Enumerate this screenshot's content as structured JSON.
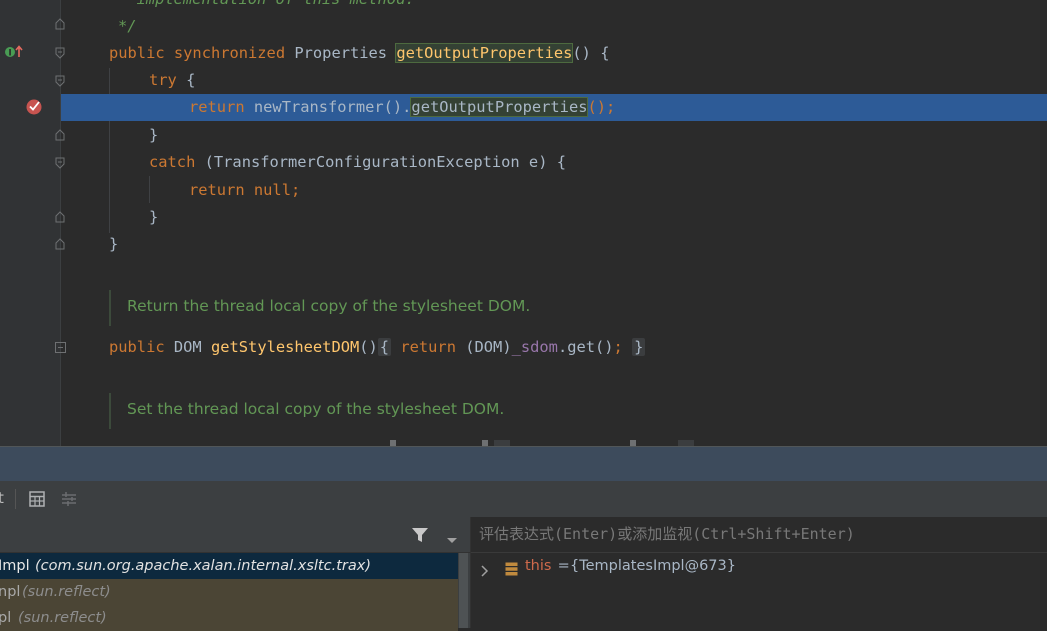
{
  "editor": {
    "lines": {
      "l0": "* implementation of this method.",
      "l1": "*/",
      "l2_kw1": "public",
      "l2_kw2": "synchronized",
      "l2_type": "Properties",
      "l2_fn": "getOutputProperties",
      "l2_rest": "() {",
      "l3_kw": "try",
      "l3_rest": "{",
      "l4_kw": "return",
      "l4_call": "newTransformer().",
      "l4_fn": "getOutputProperties",
      "l4_rest": "();",
      "l5": "}",
      "l6_kw": "catch",
      "l6_rest": "(TransformerConfigurationException e) {",
      "l7_kw": "return",
      "l7_rest": "null;",
      "l8": "}",
      "l9": "}",
      "doc1": "Return the thread local copy of the stylesheet DOM.",
      "l11_kw": "public",
      "l11_type": "DOM",
      "l11_fn": "getStylesheetDOM",
      "l11_parens": "()",
      "l11_fold_open": "{",
      "l11_return": "return",
      "l11_cast": "(DOM)",
      "l11_field": "_sdom",
      "l11_call": ".get()",
      "l11_semi": ";",
      "l11_fold_close": "}",
      "doc2": "Set the thread local copy of the stylesheet DOM."
    },
    "gutter": {
      "override_icon": "implementing-method-icon",
      "breakpoint_icon": "breakpoint-icon"
    }
  },
  "debugger": {
    "toolbar": {
      "left_glyph": "t",
      "table_icon": "table-view-icon",
      "settings_icon": "layout-settings-icon"
    },
    "frames": [
      {
        "name": "Impl",
        "pkg": "(com.sun.org.apache.xalan.internal.xsltc.trax)",
        "selected": true
      },
      {
        "name": "npl",
        "pkg": "(sun.reflect)",
        "selected": false
      },
      {
        "name": "pl",
        "pkg": "(sun.reflect)",
        "selected": false
      }
    ],
    "evaluate_placeholder": "评估表达式(Enter)或添加监视(Ctrl+Shift+Enter)",
    "variables": [
      {
        "name": "this",
        "eq": " = ",
        "value": "{TemplatesImpl@673}"
      }
    ]
  },
  "colors": {
    "background": "#2b2b2b",
    "selection": "#2d5b97",
    "keyword": "#cc7832",
    "method": "#ffc66d",
    "field": "#9876aa",
    "comment": "#629755",
    "frame_selected": "#0d293e"
  }
}
